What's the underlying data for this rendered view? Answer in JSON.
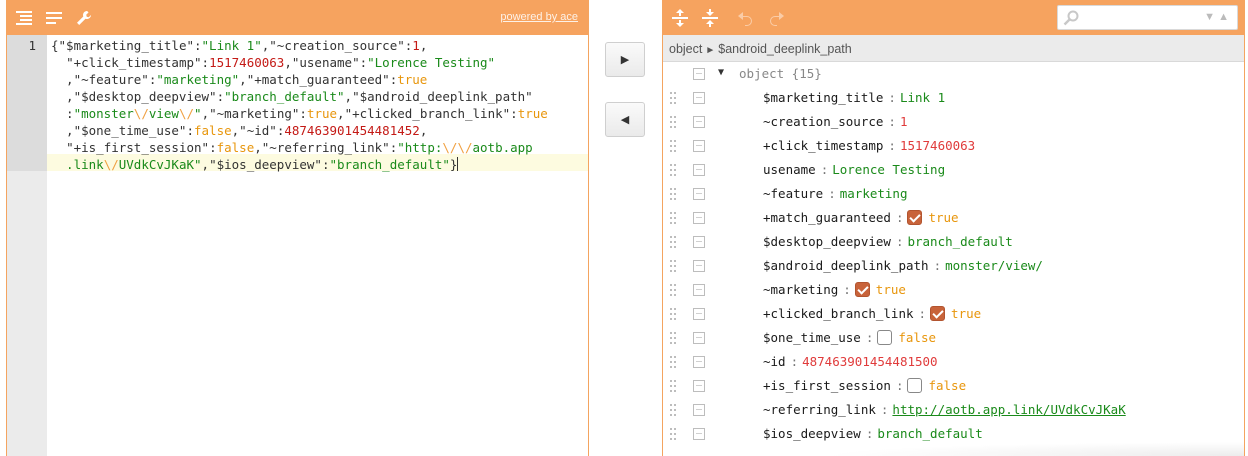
{
  "left": {
    "powered_by": "powered by ace",
    "line_number": "1",
    "code_lines": [
      [
        [
          "p",
          "{"
        ],
        [
          "k",
          "\"$marketing_title\""
        ],
        [
          "p",
          ":"
        ],
        [
          "s",
          "\"Link 1\""
        ],
        [
          "p",
          ","
        ],
        [
          "k",
          "\"~creation_source\""
        ],
        [
          "p",
          ":"
        ],
        [
          "n",
          "1"
        ],
        [
          "p",
          ","
        ]
      ],
      [
        [
          "p",
          "  "
        ],
        [
          "k",
          "\"+click_timestamp\""
        ],
        [
          "p",
          ":"
        ],
        [
          "n",
          "1517460063"
        ],
        [
          "p",
          ","
        ],
        [
          "k",
          "\"usename\""
        ],
        [
          "p",
          ":"
        ],
        [
          "s",
          "\"Lorence Testing\""
        ]
      ],
      [
        [
          "p",
          "  ,"
        ],
        [
          "k",
          "\"~feature\""
        ],
        [
          "p",
          ":"
        ],
        [
          "s",
          "\"marketing\""
        ],
        [
          "p",
          ","
        ],
        [
          "k",
          "\"+match_guaranteed\""
        ],
        [
          "p",
          ":"
        ],
        [
          "b",
          "true"
        ]
      ],
      [
        [
          "p",
          "  ,"
        ],
        [
          "k",
          "\"$desktop_deepview\""
        ],
        [
          "p",
          ":"
        ],
        [
          "s",
          "\"branch_default\""
        ],
        [
          "p",
          ","
        ],
        [
          "k",
          "\"$android_deeplink_path\""
        ]
      ],
      [
        [
          "p",
          "  :"
        ],
        [
          "s",
          "\"monster"
        ],
        [
          "r",
          "\\/"
        ],
        [
          "s",
          "view"
        ],
        [
          "r",
          "\\/"
        ],
        [
          "s",
          "\""
        ],
        [
          "p",
          ","
        ],
        [
          "k",
          "\"~marketing\""
        ],
        [
          "p",
          ":"
        ],
        [
          "b",
          "true"
        ],
        [
          "p",
          ","
        ],
        [
          "k",
          "\"+clicked_branch_link\""
        ],
        [
          "p",
          ":"
        ],
        [
          "b",
          "true"
        ]
      ],
      [
        [
          "p",
          "  ,"
        ],
        [
          "k",
          "\"$one_time_use\""
        ],
        [
          "p",
          ":"
        ],
        [
          "b",
          "false"
        ],
        [
          "p",
          ","
        ],
        [
          "k",
          "\"~id\""
        ],
        [
          "p",
          ":"
        ],
        [
          "n",
          "487463901454481452"
        ],
        [
          "p",
          ","
        ]
      ],
      [
        [
          "p",
          "  "
        ],
        [
          "k",
          "\"+is_first_session\""
        ],
        [
          "p",
          ":"
        ],
        [
          "b",
          "false"
        ],
        [
          "p",
          ","
        ],
        [
          "k",
          "\"~referring_link\""
        ],
        [
          "p",
          ":"
        ],
        [
          "s",
          "\"http:"
        ],
        [
          "r",
          "\\/\\/"
        ],
        [
          "s",
          "aotb.app"
        ]
      ],
      [
        [
          "s",
          "  .link"
        ],
        [
          "r",
          "\\/"
        ],
        [
          "s",
          "UVdkCvJKaK\""
        ],
        [
          "p",
          ","
        ],
        [
          "k",
          "\"$ios_deepview\""
        ],
        [
          "p",
          ":"
        ],
        [
          "s",
          "\"branch_default\""
        ],
        [
          "p",
          "}"
        ]
      ]
    ]
  },
  "middle": {
    "copy_right_glyph": "▶",
    "copy_left_glyph": "◀"
  },
  "right": {
    "breadcrumb": {
      "root": "object",
      "separator": "►",
      "current": "$android_deeplink_path"
    },
    "search": {
      "placeholder": "",
      "next_glyph": "▼",
      "prev_glyph": "▲"
    },
    "root": {
      "toggle": "▼",
      "label": "object {15}"
    },
    "fields": [
      {
        "key": "$marketing_title",
        "type": "string",
        "value": "Link 1"
      },
      {
        "key": "~creation_source",
        "type": "number",
        "value": "1"
      },
      {
        "key": "+click_timestamp",
        "type": "number",
        "value": "1517460063"
      },
      {
        "key": "usename",
        "type": "string",
        "value": "Lorence Testing"
      },
      {
        "key": "~feature",
        "type": "string",
        "value": "marketing"
      },
      {
        "key": "+match_guaranteed",
        "type": "boolean",
        "checked": true,
        "value": "true"
      },
      {
        "key": "$desktop_deepview",
        "type": "string",
        "value": "branch_default"
      },
      {
        "key": "$android_deeplink_path",
        "type": "string",
        "value": "monster/view/"
      },
      {
        "key": "~marketing",
        "type": "boolean",
        "checked": true,
        "value": "true"
      },
      {
        "key": "+clicked_branch_link",
        "type": "boolean",
        "checked": true,
        "value": "true"
      },
      {
        "key": "$one_time_use",
        "type": "boolean",
        "checked": false,
        "value": "false"
      },
      {
        "key": "~id",
        "type": "number",
        "value": "487463901454481500"
      },
      {
        "key": "+is_first_session",
        "type": "boolean",
        "checked": false,
        "value": "false"
      },
      {
        "key": "~referring_link",
        "type": "link",
        "value": "http://aotb.app.link/UVdkCvJKaK"
      },
      {
        "key": "$ios_deepview",
        "type": "string",
        "value": "branch_default"
      }
    ]
  },
  "colors": {
    "accent": "#f6a35f",
    "string": "#1a8a1a",
    "number": "#e03b3b",
    "boolean": "#e8960c",
    "checkbox_on": "#c8633a"
  }
}
